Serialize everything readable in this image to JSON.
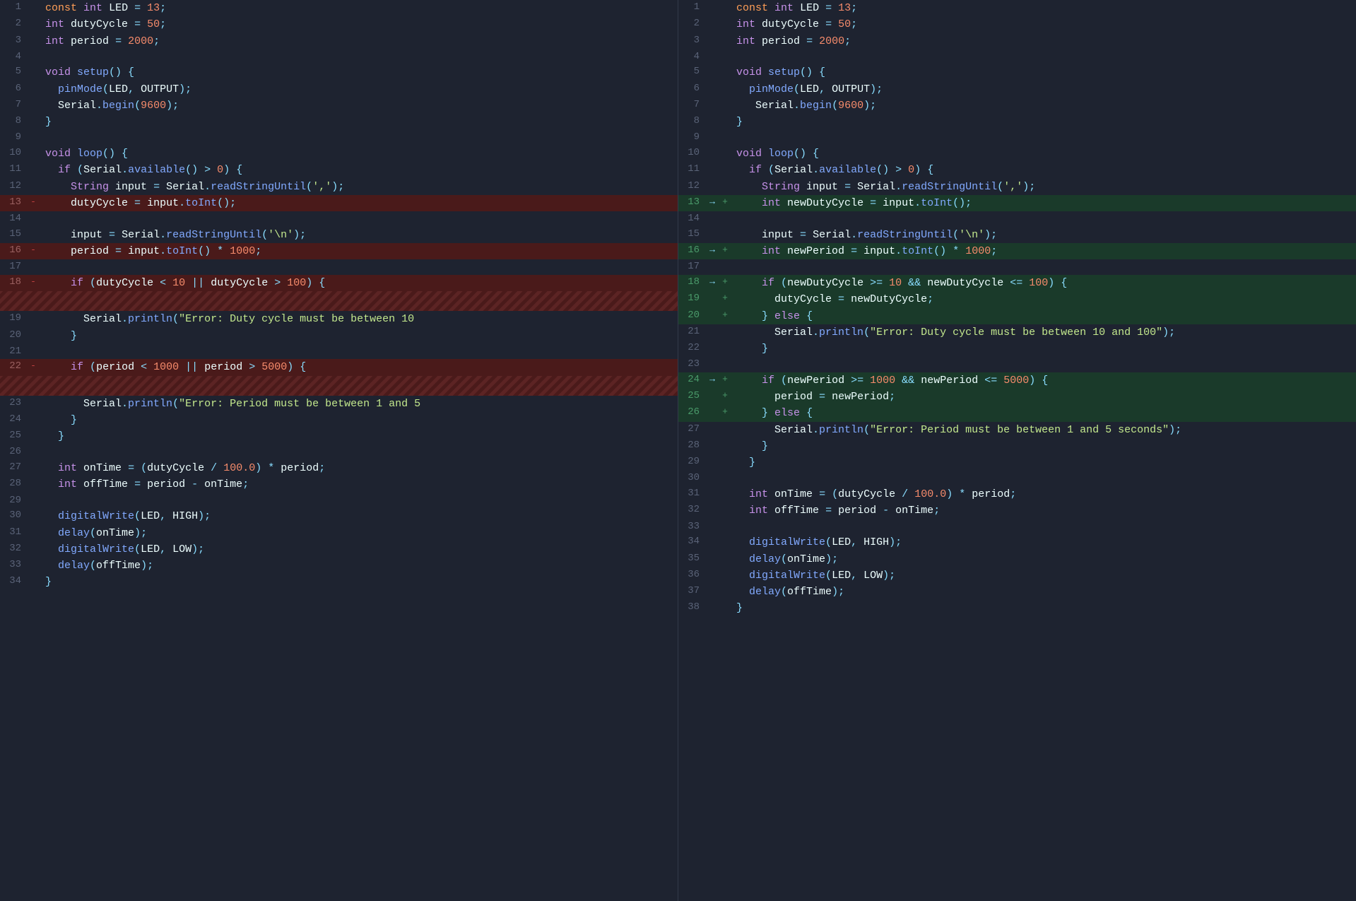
{
  "left": {
    "lines": [
      {
        "n": 1,
        "type": "normal",
        "marker": "",
        "html": "<span class='kw2'>const</span> <span class='kw'>int</span> <span class='var2'>LED</span> <span class='op'>=</span> <span class='num'>13</span><span class='punct'>;</span>"
      },
      {
        "n": 2,
        "type": "normal",
        "marker": "",
        "html": "<span class='kw'>int</span> <span class='var2'>dutyCycle</span> <span class='op'>=</span> <span class='num'>50</span><span class='punct'>;</span>"
      },
      {
        "n": 3,
        "type": "normal",
        "marker": "",
        "html": "<span class='kw'>int</span> <span class='var2'>period</span> <span class='op'>=</span> <span class='num'>2000</span><span class='punct'>;</span>"
      },
      {
        "n": 4,
        "type": "normal",
        "marker": "",
        "html": ""
      },
      {
        "n": 5,
        "type": "normal",
        "marker": "",
        "html": "<span class='kw'>void</span> <span class='fn'>setup</span><span class='punct'>() {</span>"
      },
      {
        "n": 6,
        "type": "normal",
        "marker": "",
        "html": "  <span class='fn'>pinMode</span><span class='punct'>(</span><span class='var2'>LED</span><span class='punct'>,</span> <span class='var2'>OUTPUT</span><span class='punct'>);</span>"
      },
      {
        "n": 7,
        "type": "normal",
        "marker": "",
        "html": "  <span class='var2'>Serial</span><span class='punct'>.</span><span class='method'>begin</span><span class='punct'>(</span><span class='num'>9600</span><span class='punct'>);</span>"
      },
      {
        "n": 8,
        "type": "normal",
        "marker": "",
        "html": "<span class='punct'>}</span>"
      },
      {
        "n": 9,
        "type": "normal",
        "marker": "",
        "html": ""
      },
      {
        "n": 10,
        "type": "normal",
        "marker": "",
        "html": "<span class='kw'>void</span> <span class='fn'>loop</span><span class='punct'>() {</span>"
      },
      {
        "n": 11,
        "type": "normal",
        "marker": "",
        "html": "  <span class='kw'>if</span> <span class='punct'>(</span><span class='var2'>Serial</span><span class='punct'>.</span><span class='method'>available</span><span class='punct'>()</span> <span class='op'>&gt;</span> <span class='num'>0</span><span class='punct'>) {</span>"
      },
      {
        "n": 12,
        "type": "normal",
        "marker": "",
        "html": "    <span class='kw'>String</span> <span class='var2'>input</span> <span class='op'>=</span> <span class='var2'>Serial</span><span class='punct'>.</span><span class='method'>readStringUntil</span><span class='punct'>(</span><span class='str'>','</span><span class='punct'>);</span>"
      },
      {
        "n": 13,
        "type": "deleted",
        "marker": "-",
        "html": "    <span class='var2'>dutyCycle</span> <span class='op'>=</span> <span class='var2'>input</span><span class='punct'>.</span><span class='method'>toInt</span><span class='punct'>();</span>"
      },
      {
        "n": 14,
        "type": "normal",
        "marker": "",
        "html": ""
      },
      {
        "n": 15,
        "type": "normal",
        "marker": "",
        "html": "    <span class='var2'>input</span> <span class='op'>=</span> <span class='var2'>Serial</span><span class='punct'>.</span><span class='method'>readStringUntil</span><span class='punct'>(</span><span class='str'>'\\n'</span><span class='punct'>);</span>"
      },
      {
        "n": 16,
        "type": "deleted",
        "marker": "-",
        "html": "    <span class='var2'>period</span> <span class='op'>=</span> <span class='var2'>input</span><span class='punct'>.</span><span class='method'>toInt</span><span class='punct'>()</span> <span class='op'>*</span> <span class='num'>1000</span><span class='punct'>;</span>"
      },
      {
        "n": 17,
        "type": "normal",
        "marker": "",
        "html": ""
      },
      {
        "n": 18,
        "type": "deleted",
        "marker": "-",
        "html": "    <span class='kw'>if</span> <span class='punct'>(</span><span class='var2'>dutyCycle</span> <span class='op'>&lt;</span> <span class='num'>10</span> <span class='op'>||</span> <span class='var2'>dutyCycle</span> <span class='op'>&gt;</span> <span class='num'>100</span><span class='punct'>) {</span>"
      },
      {
        "n": "hatch1",
        "type": "hatch-deleted",
        "marker": "",
        "html": ""
      },
      {
        "n": 19,
        "type": "normal",
        "marker": "",
        "html": "      <span class='var2'>Serial</span><span class='punct'>.</span><span class='method'>println</span><span class='punct'>(</span><span class='str'>\"Error: Duty cycle must be between 10</span>"
      },
      {
        "n": 20,
        "type": "normal",
        "marker": "",
        "html": "    <span class='punct'>}</span>"
      },
      {
        "n": 21,
        "type": "normal",
        "marker": "",
        "html": ""
      },
      {
        "n": 22,
        "type": "deleted",
        "marker": "-",
        "html": "    <span class='kw'>if</span> <span class='punct'>(</span><span class='var2'>period</span> <span class='op'>&lt;</span> <span class='num'>1000</span> <span class='op'>||</span> <span class='var2'>period</span> <span class='op'>&gt;</span> <span class='num'>5000</span><span class='punct'>) {</span>"
      },
      {
        "n": "hatch2",
        "type": "hatch-deleted",
        "marker": "",
        "html": ""
      },
      {
        "n": 23,
        "type": "normal",
        "marker": "",
        "html": "      <span class='var2'>Serial</span><span class='punct'>.</span><span class='method'>println</span><span class='punct'>(</span><span class='str'>\"Error: Period must be between 1 and 5</span>"
      },
      {
        "n": 24,
        "type": "normal",
        "marker": "",
        "html": "    <span class='punct'>}</span>"
      },
      {
        "n": 25,
        "type": "normal",
        "marker": "",
        "html": "  <span class='punct'>}</span>"
      },
      {
        "n": 26,
        "type": "normal",
        "marker": "",
        "html": ""
      },
      {
        "n": 27,
        "type": "normal",
        "marker": "",
        "html": "  <span class='kw'>int</span> <span class='var2'>onTime</span> <span class='op'>=</span> <span class='punct'>(</span><span class='var2'>dutyCycle</span> <span class='op'>/</span> <span class='num'>100.0</span><span class='punct'>)</span> <span class='op'>*</span> <span class='var2'>period</span><span class='punct'>;</span>"
      },
      {
        "n": 28,
        "type": "normal",
        "marker": "",
        "html": "  <span class='kw'>int</span> <span class='var2'>offTime</span> <span class='op'>=</span> <span class='var2'>period</span> <span class='op'>-</span> <span class='var2'>onTime</span><span class='punct'>;</span>"
      },
      {
        "n": 29,
        "type": "normal",
        "marker": "",
        "html": ""
      },
      {
        "n": 30,
        "type": "normal",
        "marker": "",
        "html": "  <span class='fn'>digitalWrite</span><span class='punct'>(</span><span class='var2'>LED</span><span class='punct'>,</span> <span class='var2'>HIGH</span><span class='punct'>);</span>"
      },
      {
        "n": 31,
        "type": "normal",
        "marker": "",
        "html": "  <span class='fn'>delay</span><span class='punct'>(</span><span class='var2'>onTime</span><span class='punct'>);</span>"
      },
      {
        "n": 32,
        "type": "normal",
        "marker": "",
        "html": "  <span class='fn'>digitalWrite</span><span class='punct'>(</span><span class='var2'>LED</span><span class='punct'>,</span> <span class='var2'>LOW</span><span class='punct'>);</span>"
      },
      {
        "n": 33,
        "type": "normal",
        "marker": "",
        "html": "  <span class='fn'>delay</span><span class='punct'>(</span><span class='var2'>offTime</span><span class='punct'>);</span>"
      },
      {
        "n": 34,
        "type": "normal",
        "marker": "",
        "html": "<span class='punct'>}</span>"
      }
    ]
  },
  "right": {
    "lines": [
      {
        "n": 1,
        "type": "normal",
        "marker": "",
        "html": "<span class='kw2'>const</span> <span class='kw'>int</span> <span class='var2'>LED</span> <span class='op'>=</span> <span class='num'>13</span><span class='punct'>;</span>"
      },
      {
        "n": 2,
        "type": "normal",
        "marker": "",
        "html": "<span class='kw'>int</span> <span class='var2'>dutyCycle</span> <span class='op'>=</span> <span class='num'>50</span><span class='punct'>;</span>"
      },
      {
        "n": 3,
        "type": "normal",
        "marker": "",
        "html": "<span class='kw'>int</span> <span class='var2'>period</span> <span class='op'>=</span> <span class='num'>2000</span><span class='punct'>;</span>"
      },
      {
        "n": 4,
        "type": "normal",
        "marker": "",
        "html": ""
      },
      {
        "n": 5,
        "type": "normal",
        "marker": "",
        "html": "<span class='kw'>void</span> <span class='fn'>setup</span><span class='punct'>() {</span>"
      },
      {
        "n": 6,
        "type": "normal",
        "marker": "",
        "html": "  <span class='fn'>pinMode</span><span class='punct'>(</span><span class='var2'>LED</span><span class='punct'>,</span> <span class='var2'>OUTPUT</span><span class='punct'>);</span>"
      },
      {
        "n": 7,
        "type": "normal",
        "marker": "",
        "html": "   <span class='var2'>Serial</span><span class='punct'>.</span><span class='method'>begin</span><span class='punct'>(</span><span class='num'>9600</span><span class='punct'>);</span>"
      },
      {
        "n": 8,
        "type": "normal",
        "marker": "",
        "html": "<span class='punct'>}</span>"
      },
      {
        "n": 9,
        "type": "normal",
        "marker": "",
        "html": ""
      },
      {
        "n": 10,
        "type": "normal",
        "marker": "",
        "html": "<span class='kw'>void</span> <span class='fn'>loop</span><span class='punct'>() {</span>"
      },
      {
        "n": 11,
        "type": "normal",
        "marker": "",
        "html": "  <span class='kw'>if</span> <span class='punct'>(</span><span class='var2'>Serial</span><span class='punct'>.</span><span class='method'>available</span><span class='punct'>()</span> <span class='op'>&gt;</span> <span class='num'>0</span><span class='punct'>) {</span>"
      },
      {
        "n": 12,
        "type": "normal",
        "marker": "",
        "html": "    <span class='kw'>String</span> <span class='var2'>input</span> <span class='op'>=</span> <span class='var2'>Serial</span><span class='punct'>.</span><span class='method'>readStringUntil</span><span class='punct'>(</span><span class='str'>','</span><span class='punct'>);</span>"
      },
      {
        "n": 13,
        "type": "added",
        "marker": "+",
        "html": "    <span class='kw'>int</span> <span class='var2'>newDutyCycle</span> <span class='op'>=</span> <span class='var2'>input</span><span class='punct'>.</span><span class='method'>toInt</span><span class='punct'>();</span>"
      },
      {
        "n": 14,
        "type": "normal",
        "marker": "",
        "html": ""
      },
      {
        "n": 15,
        "type": "normal",
        "marker": "",
        "html": "    <span class='var2'>input</span> <span class='op'>=</span> <span class='var2'>Serial</span><span class='punct'>.</span><span class='method'>readStringUntil</span><span class='punct'>(</span><span class='str'>'\\n'</span><span class='punct'>);</span>"
      },
      {
        "n": 16,
        "type": "added",
        "marker": "+",
        "html": "    <span class='kw'>int</span> <span class='var2'>newPeriod</span> <span class='op'>=</span> <span class='var2'>input</span><span class='punct'>.</span><span class='method'>toInt</span><span class='punct'>()</span> <span class='op'>*</span> <span class='num'>1000</span><span class='punct'>;</span>"
      },
      {
        "n": 17,
        "type": "normal",
        "marker": "",
        "html": ""
      },
      {
        "n": 18,
        "type": "added",
        "marker": "+",
        "html": "    <span class='kw'>if</span> <span class='punct'>(</span><span class='var2'>newDutyCycle</span> <span class='op'>&gt;=</span> <span class='num'>10</span> <span class='op'>&amp;&amp;</span> <span class='var2'>newDutyCycle</span> <span class='op'>&lt;=</span> <span class='num'>100</span><span class='punct'>) {</span>"
      },
      {
        "n": 19,
        "type": "added",
        "marker": "+",
        "html": "      <span class='var2'>dutyCycle</span> <span class='op'>=</span> <span class='var2'>newDutyCycle</span><span class='punct'>;</span>"
      },
      {
        "n": 20,
        "type": "added",
        "marker": "+",
        "html": "    <span class='punct'>}</span> <span class='kw'>else</span> <span class='punct'>{</span>"
      },
      {
        "n": 21,
        "type": "normal",
        "marker": "",
        "html": "      <span class='var2'>Serial</span><span class='punct'>.</span><span class='method'>println</span><span class='punct'>(</span><span class='str'>\"Error: Duty cycle must be between 10 and 100\"</span><span class='punct'>);</span>"
      },
      {
        "n": 22,
        "type": "normal",
        "marker": "",
        "html": "    <span class='punct'>}</span>"
      },
      {
        "n": 23,
        "type": "normal",
        "marker": "",
        "html": ""
      },
      {
        "n": 24,
        "type": "added",
        "marker": "+",
        "html": "    <span class='kw'>if</span> <span class='punct'>(</span><span class='var2'>newPeriod</span> <span class='op'>&gt;=</span> <span class='num'>1000</span> <span class='op'>&amp;&amp;</span> <span class='var2'>newPeriod</span> <span class='op'>&lt;=</span> <span class='num'>5000</span><span class='punct'>) {</span>"
      },
      {
        "n": 25,
        "type": "added",
        "marker": "+",
        "html": "      <span class='var2'>period</span> <span class='op'>=</span> <span class='var2'>newPeriod</span><span class='punct'>;</span>"
      },
      {
        "n": 26,
        "type": "added",
        "marker": "+",
        "html": "    <span class='punct'>}</span> <span class='kw'>else</span> <span class='punct'>{</span>"
      },
      {
        "n": 27,
        "type": "normal",
        "marker": "",
        "html": "      <span class='var2'>Serial</span><span class='punct'>.</span><span class='method'>println</span><span class='punct'>(</span><span class='str'>\"Error: Period must be between 1 and 5 seconds\"</span><span class='punct'>);</span>"
      },
      {
        "n": 28,
        "type": "normal",
        "marker": "",
        "html": "    <span class='punct'>}</span>"
      },
      {
        "n": 29,
        "type": "normal",
        "marker": "",
        "html": "  <span class='punct'>}</span>"
      },
      {
        "n": 30,
        "type": "normal",
        "marker": "",
        "html": ""
      },
      {
        "n": 31,
        "type": "normal",
        "marker": "",
        "html": "  <span class='kw'>int</span> <span class='var2'>onTime</span> <span class='op'>=</span> <span class='punct'>(</span><span class='var2'>dutyCycle</span> <span class='op'>/</span> <span class='num'>100.0</span><span class='punct'>)</span> <span class='op'>*</span> <span class='var2'>period</span><span class='punct'>;</span>"
      },
      {
        "n": 32,
        "type": "normal",
        "marker": "",
        "html": "  <span class='kw'>int</span> <span class='var2'>offTime</span> <span class='op'>=</span> <span class='var2'>period</span> <span class='op'>-</span> <span class='var2'>onTime</span><span class='punct'>;</span>"
      },
      {
        "n": 33,
        "type": "normal",
        "marker": "",
        "html": ""
      },
      {
        "n": 34,
        "type": "normal",
        "marker": "",
        "html": "  <span class='fn'>digitalWrite</span><span class='punct'>(</span><span class='var2'>LED</span><span class='punct'>,</span> <span class='var2'>HIGH</span><span class='punct'>);</span>"
      },
      {
        "n": 35,
        "type": "normal",
        "marker": "",
        "html": "  <span class='fn'>delay</span><span class='punct'>(</span><span class='var2'>onTime</span><span class='punct'>);</span>"
      },
      {
        "n": 36,
        "type": "normal",
        "marker": "",
        "html": "  <span class='fn'>digitalWrite</span><span class='punct'>(</span><span class='var2'>LED</span><span class='punct'>,</span> <span class='var2'>LOW</span><span class='punct'>);</span>"
      },
      {
        "n": 37,
        "type": "normal",
        "marker": "",
        "html": "  <span class='fn'>delay</span><span class='punct'>(</span><span class='var2'>offTime</span><span class='punct'>);</span>"
      },
      {
        "n": 38,
        "type": "normal",
        "marker": "",
        "html": "<span class='punct'>}</span>"
      }
    ]
  }
}
